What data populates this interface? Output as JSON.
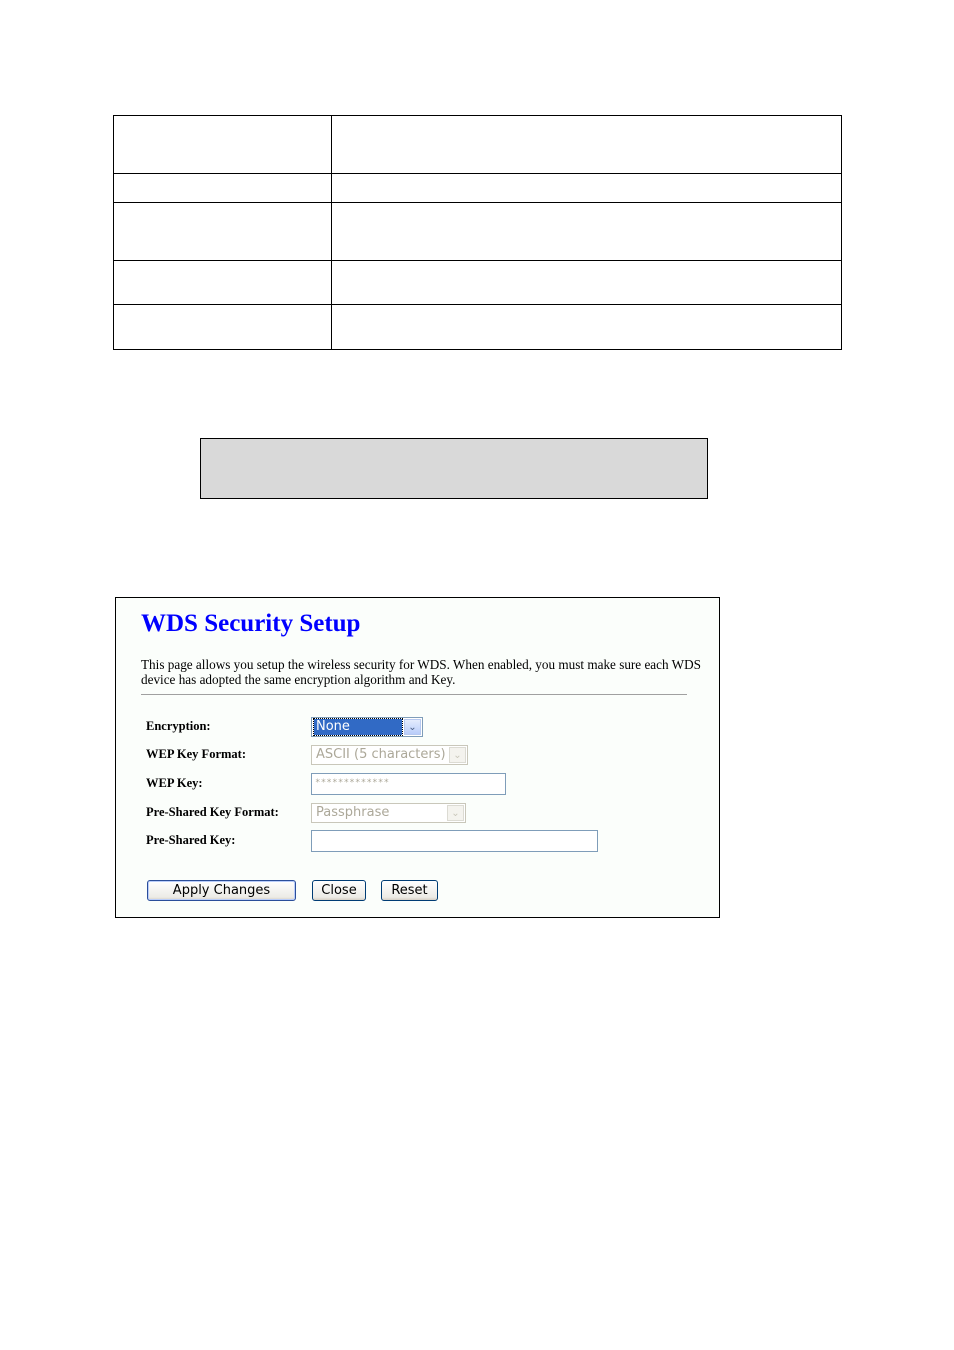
{
  "document": {
    "table_rows": [
      {
        "label": "",
        "description": ""
      },
      {
        "label": "",
        "description": ""
      },
      {
        "label": "",
        "description": ""
      },
      {
        "label": "",
        "description": ""
      },
      {
        "label": "",
        "description": ""
      }
    ],
    "note_box_text": ""
  },
  "wds_security": {
    "title": "WDS Security Setup",
    "description": "This page allows you setup the wireless security for WDS. When enabled, you must make sure each WDS device has adopted the same encryption algorithm and Key.",
    "fields": {
      "encryption": {
        "label": "Encryption:",
        "value": "None",
        "icon": "chevron-down-icon"
      },
      "wep_key_format": {
        "label": "WEP Key Format:",
        "value": "ASCII (5 characters)",
        "disabled": true,
        "icon": "chevron-down-icon"
      },
      "wep_key": {
        "label": "WEP Key:",
        "value": "*************",
        "disabled": true
      },
      "psk_format": {
        "label": "Pre-Shared Key Format:",
        "value": "Passphrase",
        "disabled": true,
        "icon": "chevron-down-icon"
      },
      "psk": {
        "label": "Pre-Shared Key:",
        "value": ""
      }
    },
    "buttons": {
      "apply": "Apply Changes",
      "close": "Close",
      "reset": "Reset"
    },
    "colors": {
      "title": "#0000ff",
      "selected_option_bg": "#316ac5",
      "disabled_text": "#aca899"
    }
  }
}
